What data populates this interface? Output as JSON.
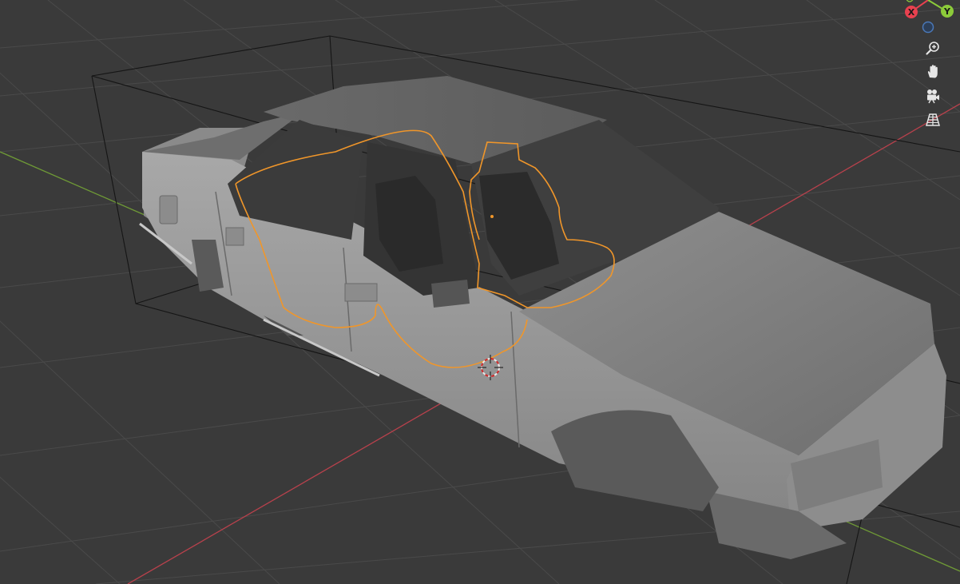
{
  "viewport": {
    "background": "#3a3a3a",
    "grid_color": "#474747",
    "x_axis_color": "#c0434f",
    "y_axis_color": "#7aa63c",
    "selection_outline_color": "#f0962a"
  },
  "gizmo": {
    "x_label": "X",
    "y_label": "Y",
    "x_color": "#e8414f",
    "y_color": "#8ccb3a",
    "z_neg_color": "#4a78b8"
  },
  "nav_controls": [
    {
      "name": "zoom",
      "icon": "zoom-in-icon"
    },
    {
      "name": "pan",
      "icon": "hand-icon"
    },
    {
      "name": "camera",
      "icon": "camera-icon"
    },
    {
      "name": "perspective",
      "icon": "grid-perspective-icon"
    }
  ],
  "scene_object": {
    "type": "car-body-mesh",
    "material_color": "#9b9b9b",
    "selected": true
  }
}
